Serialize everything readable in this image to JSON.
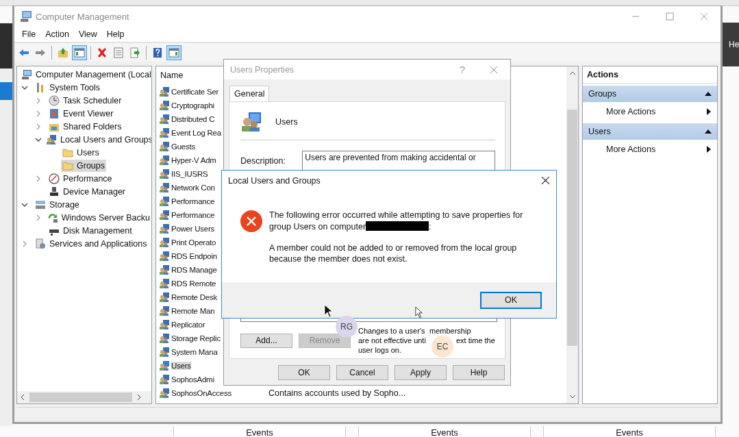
{
  "desktop": {
    "side_label": "He",
    "bottom_tabs": [
      "Events",
      "Events",
      "Events"
    ]
  },
  "main_window": {
    "title": "Computer Management",
    "menu": [
      "File",
      "Action",
      "View",
      "Help"
    ],
    "toolbar": [
      {
        "kind": "back",
        "pressed": false
      },
      {
        "kind": "forward",
        "pressed": false
      },
      {
        "kind": "separator"
      },
      {
        "kind": "up",
        "pressed": false
      },
      {
        "kind": "tree",
        "pressed": true
      },
      {
        "kind": "separator"
      },
      {
        "kind": "delete",
        "pressed": false
      },
      {
        "kind": "properties",
        "pressed": false
      },
      {
        "kind": "export",
        "pressed": false
      },
      {
        "kind": "separator"
      },
      {
        "kind": "help",
        "pressed": false
      },
      {
        "kind": "pane",
        "pressed": true
      }
    ],
    "tree": [
      {
        "label": "Computer Management (Local",
        "kind": "computer",
        "selected": false,
        "children": [
          {
            "label": "System Tools",
            "kind": "tools",
            "expanded": true,
            "selected": false,
            "children": [
              {
                "label": "Task Scheduler",
                "kind": "clock",
                "expanded": false,
                "selected": false
              },
              {
                "label": "Event Viewer",
                "kind": "log",
                "expanded": false,
                "selected": false
              },
              {
                "label": "Shared Folders",
                "kind": "share",
                "expanded": false,
                "selected": false
              },
              {
                "label": "Local Users and Groups",
                "kind": "users",
                "expanded": true,
                "selected": false,
                "children": [
                  {
                    "label": "Users",
                    "kind": "folder",
                    "selected": false
                  },
                  {
                    "label": "Groups",
                    "kind": "folder",
                    "selected": true
                  }
                ]
              },
              {
                "label": "Performance",
                "kind": "gauge",
                "expanded": false,
                "selected": false
              },
              {
                "label": "Device Manager",
                "kind": "device",
                "selected": false
              }
            ]
          },
          {
            "label": "Storage",
            "kind": "storage",
            "expanded": true,
            "selected": false,
            "children": [
              {
                "label": "Windows Server Backu",
                "kind": "backup",
                "expanded": false,
                "selected": false
              },
              {
                "label": "Disk Management",
                "kind": "disk",
                "selected": false
              }
            ]
          },
          {
            "label": "Services and Applications",
            "kind": "services",
            "expanded": false,
            "selected": false
          }
        ]
      }
    ],
    "list": {
      "columns": [
        "Name"
      ],
      "rows": [
        {
          "name": "Certificate Ser",
          "selected": false
        },
        {
          "name": "Cryptographi",
          "selected": false
        },
        {
          "name": "Distributed C",
          "selected": false
        },
        {
          "name": "Event Log Rea",
          "selected": false
        },
        {
          "name": "Guests",
          "selected": false
        },
        {
          "name": "Hyper-V Adm",
          "selected": false
        },
        {
          "name": "IIS_IUSRS",
          "selected": false
        },
        {
          "name": "Network Con",
          "selected": false
        },
        {
          "name": "Performance",
          "selected": false
        },
        {
          "name": "Performance",
          "selected": false
        },
        {
          "name": "Power Users",
          "selected": false
        },
        {
          "name": "Print Operato",
          "selected": false
        },
        {
          "name": "RDS Endpoin",
          "selected": false
        },
        {
          "name": "RDS Manage",
          "selected": false
        },
        {
          "name": "RDS Remote",
          "selected": false
        },
        {
          "name": "Remote Desk",
          "selected": false
        },
        {
          "name": "Remote Man",
          "selected": false
        },
        {
          "name": "Replicator",
          "selected": false
        },
        {
          "name": "Storage Replic",
          "selected": false
        },
        {
          "name": "System Mana",
          "selected": false
        },
        {
          "name": "Users",
          "selected": true
        },
        {
          "name": "SophosAdmi",
          "selected": false
        },
        {
          "name": "SophosOnAccess",
          "description": "Contains accounts used by Sopho...",
          "selected": false
        }
      ]
    },
    "actions": {
      "title": "Actions",
      "sections": [
        {
          "title": "Groups",
          "expanded": true,
          "items": [
            "More Actions"
          ]
        },
        {
          "title": "Users",
          "expanded": true,
          "items": [
            "More Actions"
          ]
        }
      ]
    }
  },
  "properties_dialog": {
    "title": "Users Properties",
    "help": "?",
    "tabs": [
      {
        "label": "General",
        "selected": true
      }
    ],
    "group_name": "Users",
    "description_label": "Description:",
    "description": "Users are prevented from making accidental or",
    "member_buttons": [
      {
        "label": "Add...",
        "disabled": false
      },
      {
        "label": "Remove",
        "disabled": true
      }
    ],
    "note_lines": [
      [
        "Changes to a user's",
        "membership"
      ],
      [
        "are not effective unti",
        "ext time the"
      ],
      [
        "user logs on."
      ]
    ],
    "buttons": [
      "OK",
      "Cancel",
      "Apply",
      "Help"
    ]
  },
  "error_dialog": {
    "title": "Local Users and Groups",
    "message": "The following error occurred while attempting to save properties for group Users on computer",
    "message_end": ":",
    "detail": "A member could not be added to or removed from the local group because the member does not exist.",
    "button": "OK"
  },
  "participants": [
    {
      "initials": "RG",
      "color": "#d9d5ed"
    },
    {
      "initials": "EC",
      "color": "#fde5cf"
    }
  ]
}
